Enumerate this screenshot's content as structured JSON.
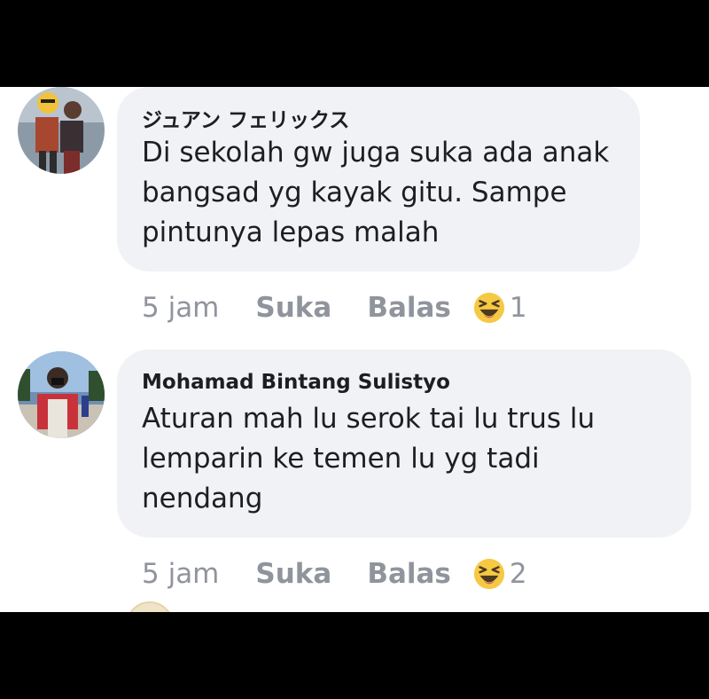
{
  "colors": {
    "bubble_bg": "#f1f2f6",
    "meta_text": "#90949c",
    "author_text": "#1c1e21",
    "reaction_yellow": "#f6c944"
  },
  "comments": [
    {
      "author": "ジュアン フェリックス",
      "text_lines": [
        "Di sekolah gw juga suka ada anak",
        "bangsad yg kayak gitu. Sampe",
        "pintunya lepas malah"
      ],
      "time": "5 jam",
      "like_label": "Suka",
      "reply_label": "Balas",
      "reaction_icon": "laughing-face-icon",
      "reaction_count": "1"
    },
    {
      "author": "Mohamad Bintang Sulistyo",
      "text_lines": [
        "Aturan mah lu serok tai lu trus lu",
        "lemparin ke temen lu yg tadi",
        "nendang"
      ],
      "time": "5 jam",
      "like_label": "Suka",
      "reply_label": "Balas",
      "reaction_icon": "laughing-face-icon",
      "reaction_count": "2"
    }
  ]
}
